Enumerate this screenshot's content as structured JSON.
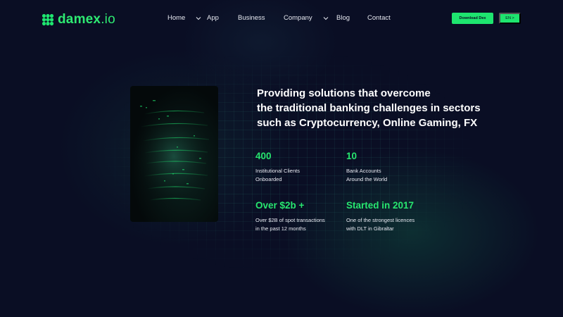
{
  "brand": {
    "name": "damex",
    "tld": ".io",
    "accent_color": "#1ee56f",
    "background_color": "#0a0e24",
    "logo_icon": "damex-flower-logo-icon"
  },
  "nav": {
    "items": [
      {
        "label": "Home",
        "has_dropdown": true
      },
      {
        "label": "App",
        "has_dropdown": false
      },
      {
        "label": "Business",
        "has_dropdown": false
      },
      {
        "label": "Company",
        "has_dropdown": true
      },
      {
        "label": "Blog",
        "has_dropdown": false
      },
      {
        "label": "Contact",
        "has_dropdown": false
      }
    ],
    "download_button": "Download Dex",
    "language_button": "EN >"
  },
  "hero": {
    "headline_lines": [
      "Providing solutions that overcome",
      "the traditional banking challenges in sectors",
      "such as Cryptocurrency, Online Gaming, FX"
    ]
  },
  "stats": [
    {
      "value": "400",
      "desc_lines": [
        "Institutional Clients",
        "Onboarded"
      ]
    },
    {
      "value": "10",
      "desc_lines": [
        "Bank Accounts",
        "Around the World"
      ]
    },
    {
      "value": "Over $2b +",
      "desc_lines": [
        "Over $2B of spot transactions",
        "in the past 12 months"
      ]
    },
    {
      "value": "Started in 2017",
      "desc_lines": [
        "One of the strongest licences",
        "with DLT in Gibraltar"
      ]
    }
  ]
}
